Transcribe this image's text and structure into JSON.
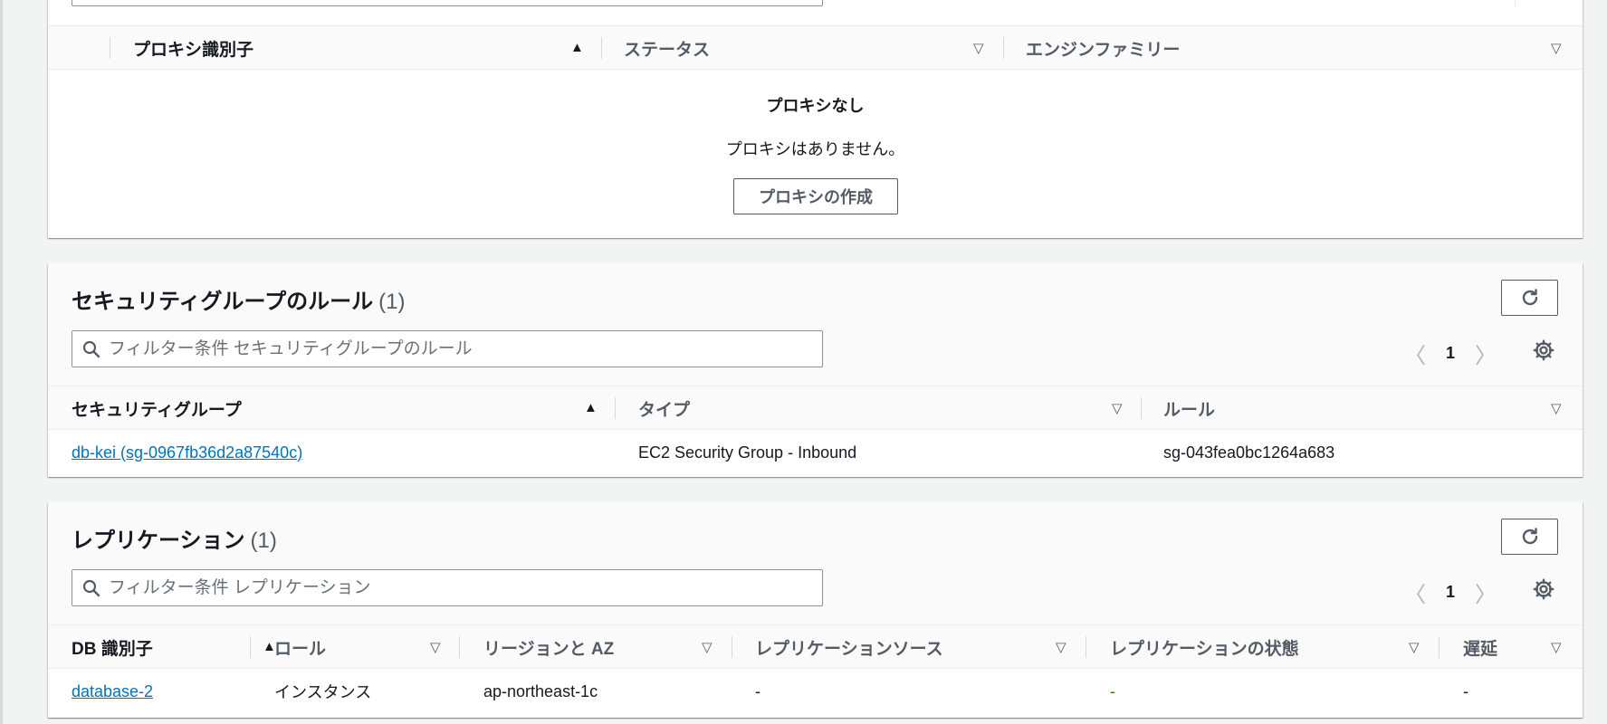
{
  "proxy": {
    "columns": [
      "プロキシ識別子",
      "ステータス",
      "エンジンファミリー"
    ],
    "sort_asc": "▲",
    "sort_desc": "▽",
    "empty_title": "プロキシなし",
    "empty_desc": "プロキシはありません。",
    "create_label": "プロキシの作成"
  },
  "security": {
    "title": "セキュリティグループのルール",
    "count": "(1)",
    "filter_placeholder": "フィルター条件 セキュリティグループのルール",
    "page": "1",
    "prev": "〈",
    "next": "〉",
    "columns": [
      "セキュリティグループ",
      "タイプ",
      "ルール"
    ],
    "rows": [
      {
        "group": "db-kei (sg-0967fb36d2a87540c)",
        "type": "EC2 Security Group - Inbound",
        "rule": "sg-043fea0bc1264a683"
      }
    ]
  },
  "replication": {
    "title": "レプリケーション",
    "count": "(1)",
    "filter_placeholder": "フィルター条件 レプリケーション",
    "page": "1",
    "prev": "〈",
    "next": "〉",
    "columns": [
      "DB 識別子",
      "ロール",
      "リージョンと AZ",
      "レプリケーションソース",
      "レプリケーションの状態",
      "遅延"
    ],
    "rows": [
      {
        "db": "database-2",
        "role": "インスタンス",
        "region": "ap-northeast-1c",
        "source": "-",
        "state": "-",
        "lag": "-"
      }
    ]
  },
  "colors": {
    "link": "#0073bb",
    "status_green": "#1d8102",
    "header_bg": "#fafafa",
    "page_bg": "#f2f3f3"
  },
  "icons": [
    "search-icon",
    "refresh-icon",
    "settings-gear-icon",
    "sort-asc-icon",
    "sort-desc-icon",
    "chevron-left-icon",
    "chevron-right-icon"
  ]
}
